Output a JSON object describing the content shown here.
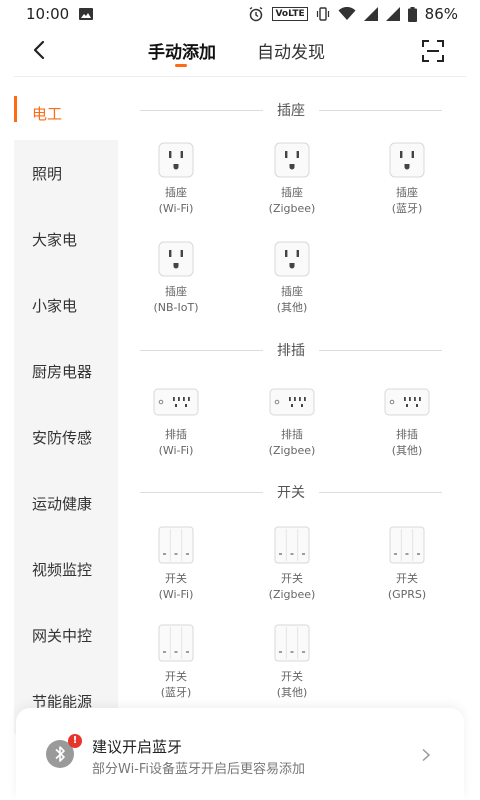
{
  "status_bar": {
    "time": "10:00",
    "lte": "VoLTE",
    "battery": "86%"
  },
  "nav": {
    "tabs": [
      {
        "label": "手动添加",
        "active": true
      },
      {
        "label": "自动发现",
        "active": false
      }
    ]
  },
  "sidebar": {
    "items": [
      {
        "label": "电工",
        "active": true
      },
      {
        "label": "照明",
        "active": false
      },
      {
        "label": "大家电",
        "active": false
      },
      {
        "label": "小家电",
        "active": false
      },
      {
        "label": "厨房电器",
        "active": false
      },
      {
        "label": "安防传感",
        "active": false
      },
      {
        "label": "运动健康",
        "active": false
      },
      {
        "label": "视频监控",
        "active": false
      },
      {
        "label": "网关中控",
        "active": false
      },
      {
        "label": "节能能源",
        "active": false
      }
    ]
  },
  "sections": [
    {
      "title": "插座",
      "devices": [
        {
          "name": "插座",
          "sub": "(Wi-Fi)",
          "icon": "socket-icon"
        },
        {
          "name": "插座",
          "sub": "(Zigbee)",
          "icon": "socket-icon"
        },
        {
          "name": "插座",
          "sub": "(蓝牙)",
          "icon": "socket-icon"
        },
        {
          "name": "插座",
          "sub": "(NB-IoT)",
          "icon": "socket-icon"
        },
        {
          "name": "插座",
          "sub": "(其他)",
          "icon": "socket-icon"
        }
      ]
    },
    {
      "title": "排插",
      "devices": [
        {
          "name": "排插",
          "sub": "(Wi-Fi)",
          "icon": "power-strip-icon"
        },
        {
          "name": "排插",
          "sub": "(Zigbee)",
          "icon": "power-strip-icon"
        },
        {
          "name": "排插",
          "sub": "(其他)",
          "icon": "power-strip-icon"
        }
      ]
    },
    {
      "title": "开关",
      "devices": [
        {
          "name": "开关",
          "sub": "(Wi-Fi)",
          "icon": "switch-icon"
        },
        {
          "name": "开关",
          "sub": "(Zigbee)",
          "icon": "switch-icon"
        },
        {
          "name": "开关",
          "sub": "(GPRS)",
          "icon": "switch-icon"
        },
        {
          "name": "开关",
          "sub": "(蓝牙)",
          "icon": "switch-icon"
        },
        {
          "name": "开关",
          "sub": "(其他)",
          "icon": "switch-icon"
        }
      ]
    }
  ],
  "bluetooth_prompt": {
    "title": "建议开启蓝牙",
    "subtitle": "部分Wi-Fi设备蓝牙开启后更容易添加",
    "badge": "!"
  },
  "colors": {
    "accent": "#ff6a14",
    "sidebar_bg": "#f5f5f5",
    "badge": "#e8352b"
  }
}
